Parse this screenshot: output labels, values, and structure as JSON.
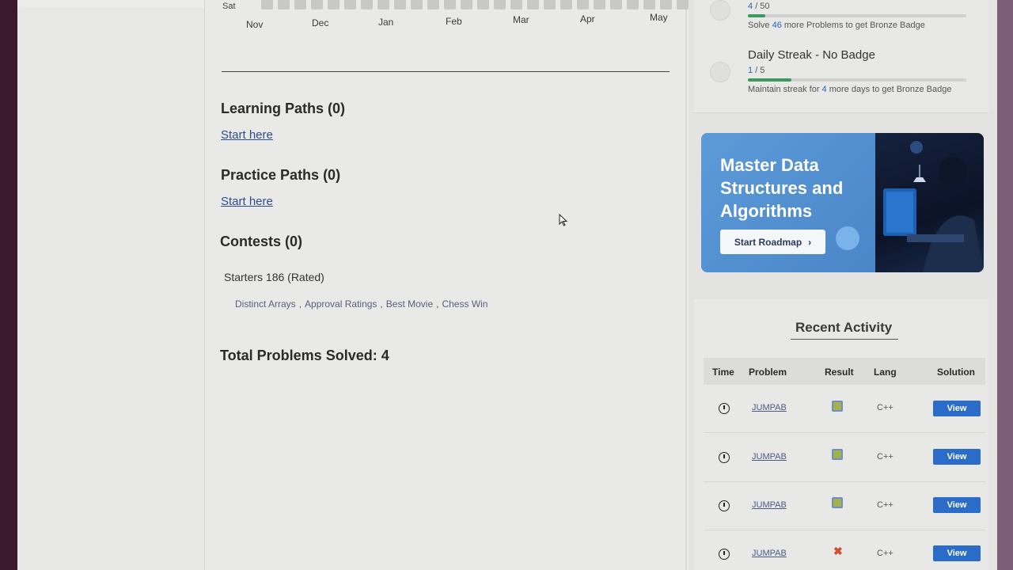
{
  "heatmap": {
    "day_label": "Sat",
    "months": [
      "Nov",
      "Dec",
      "Jan",
      "Feb",
      "Mar",
      "Apr",
      "May"
    ]
  },
  "sections": {
    "learning_paths": {
      "title": "Learning Paths (0)",
      "link": "Start here"
    },
    "practice_paths": {
      "title": "Practice Paths (0)",
      "link": "Start here"
    },
    "contests": {
      "title": "Contests (0)",
      "contest_name": "Starters 186 (Rated)",
      "problems": [
        "Distinct Arrays",
        "Approval Ratings",
        "Best Movie",
        "Chess Win"
      ]
    },
    "total_solved": "Total Problems Solved: 4"
  },
  "badges": {
    "problems": {
      "current": "4",
      "total": "/ 50",
      "progress": 0.08,
      "hint_pre": "Solve ",
      "hint_n": "46",
      "hint_post": " more Problems to get Bronze Badge"
    },
    "streak": {
      "title": "Daily Streak - No Badge",
      "current": "1",
      "total": "/ 5",
      "progress": 0.2,
      "hint_pre": "Maintain streak for ",
      "hint_n": "4",
      "hint_post": " more days to get Bronze Badge"
    }
  },
  "promo": {
    "title": "Master Data Structures and Algorithms",
    "button": "Start Roadmap",
    "button_icon": "chevron-right-icon"
  },
  "activity": {
    "title": "Recent Activity",
    "columns": [
      "Time",
      "Problem",
      "Result",
      "Lang",
      "Solution"
    ],
    "rows": [
      {
        "problem": "JUMPAB",
        "result": "accepted",
        "lang": "C++",
        "action": "View"
      },
      {
        "problem": "JUMPAB",
        "result": "accepted",
        "lang": "C++",
        "action": "View"
      },
      {
        "problem": "JUMPAB",
        "result": "accepted",
        "lang": "C++",
        "action": "View"
      },
      {
        "problem": "JUMPAB",
        "result": "wrong",
        "result_glyph": "✖",
        "lang": "C++",
        "action": "View"
      }
    ]
  }
}
